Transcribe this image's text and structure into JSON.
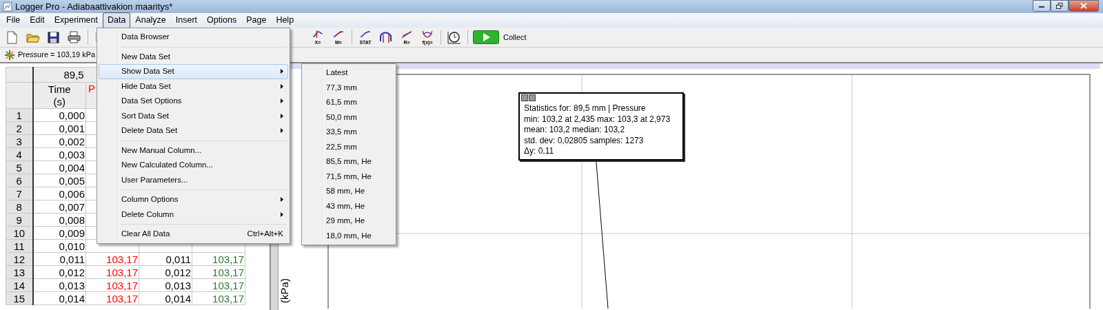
{
  "window": {
    "title": "Logger Pro - Adiabaattivakion maaritys*"
  },
  "menu_bar": [
    {
      "label": "File",
      "selected": false
    },
    {
      "label": "Edit",
      "selected": false
    },
    {
      "label": "Experiment",
      "selected": false
    },
    {
      "label": "Data",
      "selected": true
    },
    {
      "label": "Analyze",
      "selected": false
    },
    {
      "label": "Insert",
      "selected": false
    },
    {
      "label": "Options",
      "selected": false
    },
    {
      "label": "Page",
      "selected": false
    },
    {
      "label": "Help",
      "selected": false
    }
  ],
  "toolbar": {
    "left_tools": [
      {
        "kind": "new"
      },
      {
        "kind": "open"
      },
      {
        "kind": "save"
      },
      {
        "kind": "print"
      },
      {
        "kind": "paste"
      }
    ],
    "right_tools": [
      {
        "kind": "examine",
        "caption": "X="
      },
      {
        "kind": "tangent",
        "caption": "M="
      },
      {
        "kind": "stats",
        "caption": "STAT"
      },
      {
        "kind": "integral"
      },
      {
        "kind": "linear",
        "caption": "R="
      },
      {
        "kind": "curve",
        "caption": "f(x)="
      },
      {
        "kind": "timer"
      }
    ],
    "collect": {
      "label": "Collect"
    }
  },
  "meter": {
    "label": "Pressure = 103,19 kPa"
  },
  "table": {
    "dataset": "89,5",
    "columns": [
      {
        "label": "Time",
        "unit": "(s)"
      },
      {
        "label": "P"
      }
    ],
    "column_styles": [
      {
        "color": "#000000"
      },
      {
        "color": "#ff0000"
      },
      {
        "color": "#000000"
      },
      {
        "color": "#2b7a2b"
      }
    ],
    "rows": [
      {
        "number": "1",
        "cells": [
          "0,000"
        ]
      },
      {
        "number": "2",
        "cells": [
          "0,001"
        ]
      },
      {
        "number": "3",
        "cells": [
          "0,002"
        ]
      },
      {
        "number": "4",
        "cells": [
          "0,003"
        ]
      },
      {
        "number": "5",
        "cells": [
          "0,004"
        ]
      },
      {
        "number": "6",
        "cells": [
          "0,005"
        ]
      },
      {
        "number": "7",
        "cells": [
          "0,006"
        ]
      },
      {
        "number": "8",
        "cells": [
          "0,007"
        ]
      },
      {
        "number": "9",
        "cells": [
          "0,008"
        ]
      },
      {
        "number": "10",
        "cells": [
          "0,009"
        ]
      },
      {
        "number": "11",
        "cells": [
          "0,010"
        ]
      },
      {
        "number": "12",
        "cells": [
          "0,011",
          "103,17",
          "0,011",
          "103,17"
        ]
      },
      {
        "number": "13",
        "cells": [
          "0,012",
          "103,17",
          "0,012",
          "103,17"
        ]
      },
      {
        "number": "14",
        "cells": [
          "0,013",
          "103,17",
          "0,013",
          "103,17"
        ]
      },
      {
        "number": "15",
        "cells": [
          "0,014",
          "103,17",
          "0,014",
          "103,17"
        ]
      }
    ]
  },
  "data_menu": {
    "groups": [
      [
        {
          "label": "Data Browser",
          "submenu": false,
          "selected": false
        }
      ],
      [
        {
          "label": "New Data Set",
          "submenu": false,
          "selected": false
        },
        {
          "label": "Show Data Set",
          "submenu": true,
          "selected": true
        },
        {
          "label": "Hide Data Set",
          "submenu": true,
          "selected": false
        },
        {
          "label": "Data Set Options",
          "submenu": true,
          "selected": false
        },
        {
          "label": "Sort Data Set",
          "submenu": true,
          "selected": false
        },
        {
          "label": "Delete Data Set",
          "submenu": true,
          "selected": false
        }
      ],
      [
        {
          "label": "New Manual Column...",
          "submenu": false,
          "selected": false
        },
        {
          "label": "New Calculated Column...",
          "submenu": false,
          "selected": false
        },
        {
          "label": "User Parameters...",
          "submenu": false,
          "selected": false
        }
      ],
      [
        {
          "label": "Column Options",
          "submenu": true,
          "selected": false
        },
        {
          "label": "Delete Column",
          "submenu": true,
          "selected": false
        }
      ],
      [
        {
          "label": "Clear All Data",
          "submenu": false,
          "selected": false,
          "shortcut": "Ctrl+Alt+K"
        }
      ]
    ]
  },
  "show_data_set_menu": {
    "items": [
      "Latest",
      "77,3 mm",
      "61,5 mm",
      "50,0 mm",
      "33,5 mm",
      "22,5 mm",
      "85,5 mm, He",
      "71,5 mm, He",
      "58 mm, He",
      "43 mm, He",
      "29 mm, He",
      "18,0 mm, He"
    ]
  },
  "graph": {
    "y_axis_label": "(kPa)",
    "statistics": {
      "lines": [
        "Statistics for: 89,5 mm | Pressure",
        "min: 103,2 at 2,435 max: 103,3 at 2,973",
        "mean: 103,2 median: 103,2",
        "std. dev: 0,02805 samples: 1273",
        "Δy: 0,11"
      ]
    }
  }
}
